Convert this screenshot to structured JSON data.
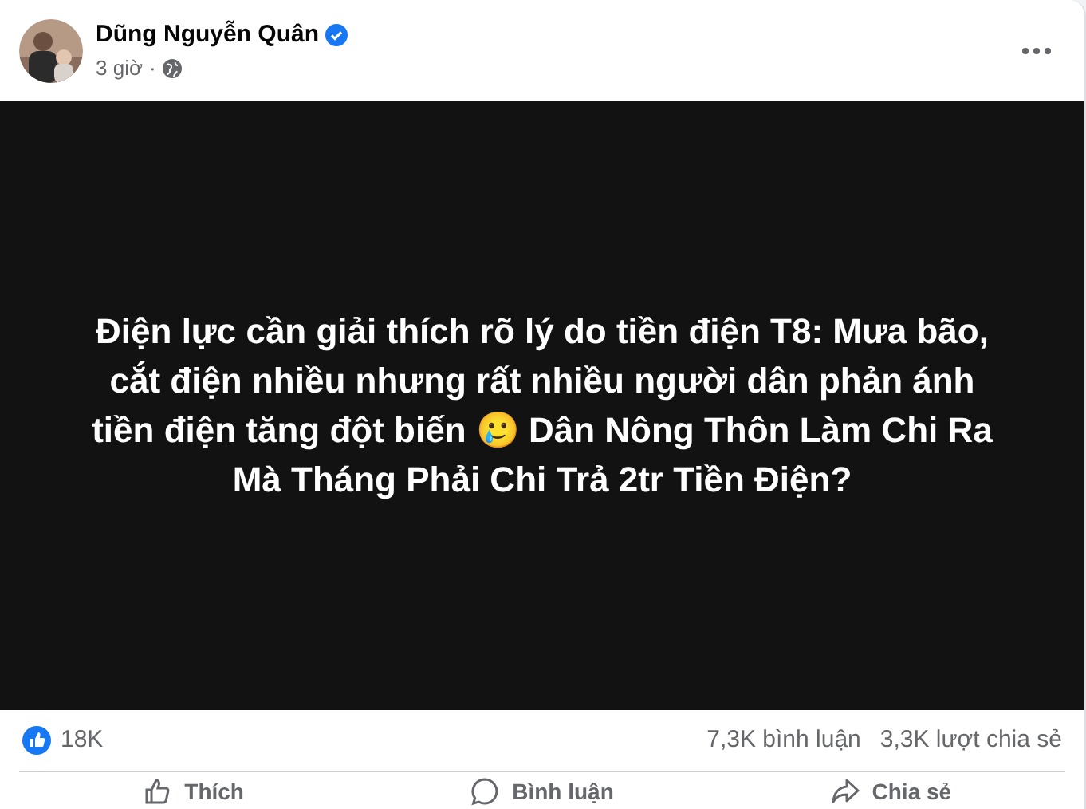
{
  "post": {
    "author": "Dũng Nguyễn Quân",
    "verified": true,
    "time": "3 giờ",
    "separator": "·"
  },
  "image_text": "Điện lực cần giải thích rõ lý do tiền điện T8: Mưa bão, cắt điện nhiều nhưng rất nhiều người dân phản ánh tiền điện tăng đột biến 🥲 Dân Nông Thôn Làm Chi Ra Mà Tháng Phải Chi Trả 2tr Tiền Điện?",
  "stats": {
    "reactions": "18K",
    "comments": "7,3K bình luận",
    "shares": "3,3K lượt chia sẻ"
  },
  "actions": [
    {
      "kind": "like",
      "label": "Thích"
    },
    {
      "kind": "comment",
      "label": "Bình luận"
    },
    {
      "kind": "share",
      "label": "Chia sẻ"
    }
  ]
}
